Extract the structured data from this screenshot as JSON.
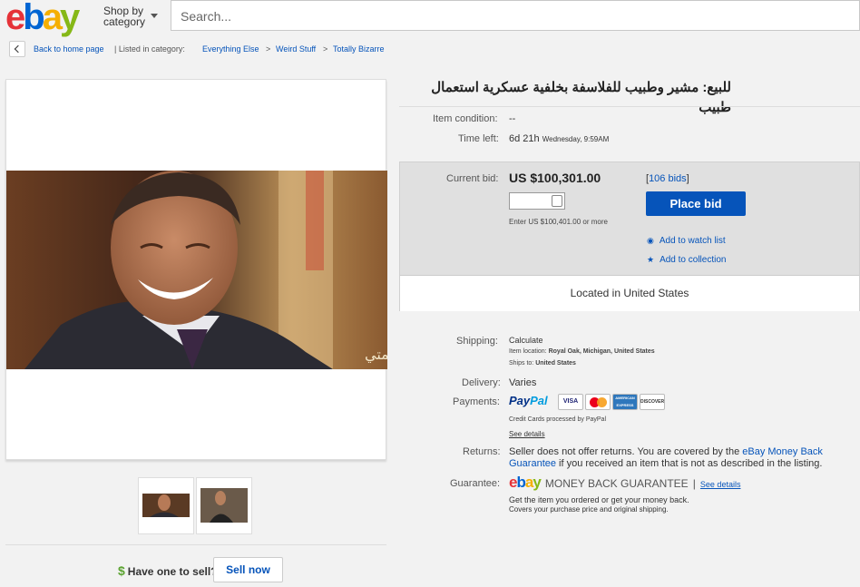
{
  "header": {
    "logo_letters": [
      "e",
      "b",
      "a",
      "y"
    ],
    "logo_colors": [
      "#e53238",
      "#0064d2",
      "#f5af02",
      "#86b817"
    ],
    "shop_by_line1": "Shop by",
    "shop_by_line2": "category",
    "search_placeholder": "Search..."
  },
  "breadcrumb": {
    "back_label": "Back to home page",
    "listed_in": "| Listed in category:",
    "items": [
      "Everything Else",
      "Weird Stuff",
      "Totally Bizarre"
    ],
    "separator": ">"
  },
  "item": {
    "title": "للبيع: مشير وطبيب للفلاسفة بخلفية عسكرية استعمال طبيب",
    "photo_watermark": "كلمتي",
    "condition_label": "Item condition:",
    "condition_value": "--",
    "time_left_label": "Time left:",
    "time_left_value": "6d 21h",
    "time_left_detail": "Wednesday, 9:59AM"
  },
  "bid": {
    "current_bid_label": "Current bid:",
    "current_bid_value": "US $100,301.00",
    "bids_open": "[",
    "bids_count": "106 bids",
    "bids_close": "]",
    "enter_hint": "Enter US $100,401.00 or more",
    "place_bid_label": "Place bid",
    "watch_label": "Add to watch list",
    "collection_label": "Add to collection",
    "located": "Located in United States"
  },
  "shipping": {
    "shipping_label": "Shipping:",
    "shipping_value": "Calculate",
    "item_location_label": "Item location:",
    "item_location_value": "Royal Oak, Michigan, United States",
    "ships_to_label": "Ships to:",
    "ships_to_value": "United States",
    "delivery_label": "Delivery:",
    "delivery_value": "Varies",
    "payments_label": "Payments:",
    "paypal_pay": "Pay",
    "paypal_pal": "Pal",
    "cards": [
      "VISA",
      "MasterCard",
      "AMERICAN EXPRESS",
      "DISCOVER"
    ],
    "cc_note": "Credit Cards processed by PayPal",
    "see_details": "See details",
    "returns_label": "Returns:",
    "returns_text1": "Seller does not offer returns. You are covered by the",
    "returns_link1": "eBay Money Back",
    "returns_link2": "Guarantee",
    "returns_text2": "if you received an item that is not as described in the listing.",
    "guarantee_label": "Guarantee:",
    "guarantee_mbg": "MONEY BACK GUARANTEE",
    "guarantee_sep": "|",
    "guarantee_see": "See details",
    "guarantee_line1": "Get the item you ordered or get your money back.",
    "guarantee_line2": "Covers your purchase price and original shipping."
  },
  "sell": {
    "have_one": "Have one to sell?",
    "sell_now": "Sell now"
  },
  "colors": {
    "link": "#0654ba",
    "button": "#0654ba",
    "paypal_dark": "#003087",
    "paypal_light": "#009cde"
  }
}
